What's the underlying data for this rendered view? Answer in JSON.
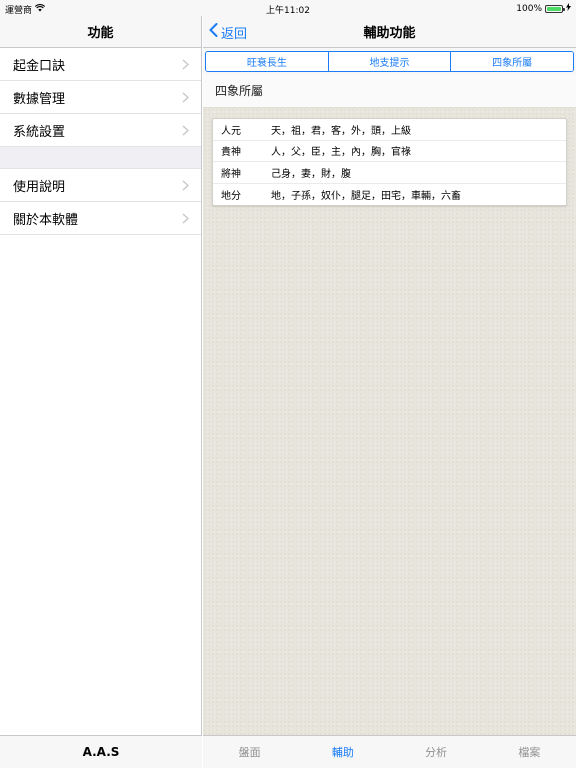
{
  "status": {
    "carrier": "運營商",
    "time": "上午11:02",
    "battery": "100%"
  },
  "master": {
    "title": "功能",
    "group1": [
      {
        "label": "起金口訣"
      },
      {
        "label": "數據管理"
      },
      {
        "label": "系統設置"
      }
    ],
    "group2": [
      {
        "label": "使用說明"
      },
      {
        "label": "關於本軟體"
      }
    ],
    "footer": "A.A.S"
  },
  "detail": {
    "back_label": "返回",
    "title": "輔助功能",
    "segments": [
      "旺衰長生",
      "地支提示",
      "四象所屬"
    ],
    "section_title": "四象所屬",
    "rows": [
      {
        "key": "人元",
        "value": "天，祖，君，客，外，頭，上級"
      },
      {
        "key": "貴神",
        "value": "人，父，臣，主，內，胸，官祿"
      },
      {
        "key": "將神",
        "value": "己身，妻，財，腹"
      },
      {
        "key": "地分",
        "value": "地，子孫，奴仆，腿足，田宅，車輛，六畜"
      }
    ],
    "tabs": [
      {
        "label": "盤面",
        "active": false
      },
      {
        "label": "輔助",
        "active": true
      },
      {
        "label": "分析",
        "active": false
      },
      {
        "label": "檔案",
        "active": false
      }
    ]
  },
  "colors": {
    "accent": "#1a7cf6",
    "battery": "#4cd964"
  }
}
